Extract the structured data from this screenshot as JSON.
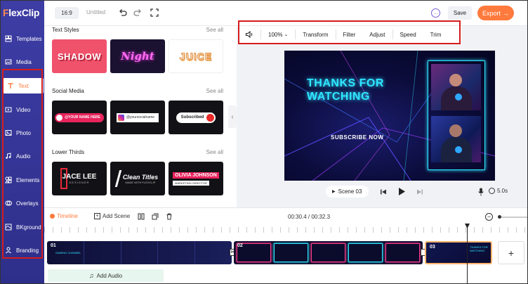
{
  "app": {
    "logo_prefix": "F",
    "logo_rest": "lexClip"
  },
  "sidebar": {
    "items": [
      {
        "label": "Templates",
        "icon": "templates-icon"
      },
      {
        "label": "Media",
        "icon": "media-icon"
      },
      {
        "label": "Text",
        "icon": "text-icon",
        "active": true
      },
      {
        "label": "Video",
        "icon": "video-icon"
      },
      {
        "label": "Photo",
        "icon": "photo-icon"
      },
      {
        "label": "Audio",
        "icon": "audio-icon"
      },
      {
        "label": "Elements",
        "icon": "elements-icon"
      },
      {
        "label": "Overlays",
        "icon": "overlays-icon"
      },
      {
        "label": "BKground",
        "icon": "background-icon"
      },
      {
        "label": "Branding",
        "icon": "branding-icon"
      }
    ]
  },
  "topbar": {
    "ratio": "16:9",
    "title": "Untitled",
    "save_label": "Save",
    "export_label": "Export",
    "export_arrow": "→",
    "chat_glyph": "…"
  },
  "library": {
    "sections": [
      {
        "title": "Text Styles",
        "see_all": "See all",
        "items": [
          {
            "text": "SHADOW"
          },
          {
            "text": "Night"
          },
          {
            "text": "JUICE"
          }
        ]
      },
      {
        "title": "Social Media",
        "see_all": "See all",
        "items": [
          {
            "text": "@YOUR NAME HERE"
          },
          {
            "text": "@yoursocialname"
          },
          {
            "text": "Subscribed"
          }
        ]
      },
      {
        "title": "Lower Thirds",
        "see_all": "See all",
        "items": [
          {
            "text": "JACE LEE",
            "sub": "DESIGNER"
          },
          {
            "text": "Clean Titles",
            "sub": "MADE WITH FLEXCLIP"
          },
          {
            "text": "OLIVIA JOHNSON",
            "sub": "MARKETING DIRECTOR"
          }
        ]
      }
    ],
    "collapse_glyph": "‹"
  },
  "preview": {
    "toolbar": {
      "zoom": "100%",
      "tools": [
        "Transform",
        "Filter",
        "Adjust",
        "Speed",
        "Trim"
      ]
    },
    "canvas": {
      "headline_line1": "THANKS FOR",
      "headline_line2": "WATCHING",
      "cta": "SUBSCRIBE NOW"
    },
    "playback": {
      "scene_label": "Scene 03",
      "duration": "5.0s"
    }
  },
  "timeline": {
    "timeline_label": "Timeline",
    "add_scene_label": "Add Scene",
    "time_display": "00:30.4 / 00:32.3",
    "clips": [
      {
        "number": "01",
        "caption": "GAMING CHANNEL"
      },
      {
        "number": "02",
        "caption": ""
      },
      {
        "number": "03",
        "caption": "THANKS FOR WATCHING"
      }
    ],
    "add_audio_label": "Add Audio",
    "add_clip_glyph": "+"
  },
  "colors": {
    "sidebar": "#3a3aa0",
    "accent": "#ff7a3d",
    "highlight_box": "#d41c1c",
    "neon_cyan": "#2fe6ff"
  }
}
